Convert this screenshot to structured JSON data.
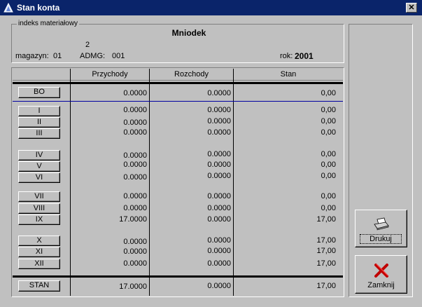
{
  "window": {
    "title": "Stan konta",
    "close_glyph": "✕"
  },
  "header": {
    "group_label": "indeks materiałowy",
    "material_name": "Mniodek",
    "code": "2",
    "magazyn_label": "magazyn:",
    "magazyn_value": "01",
    "admg_label": "ADMG:",
    "admg_value": "001",
    "rok_label": "rok:",
    "rok_value": "2001"
  },
  "table": {
    "columns": [
      "Przychody",
      "Rozchody",
      "Stan"
    ],
    "bo": {
      "label": "BO",
      "przychody": "0.0000",
      "rozchody": "0.0000",
      "stan": "0,00"
    },
    "rows": [
      {
        "label": "I",
        "przychody": "0.0000",
        "rozchody": "0.0000",
        "stan": "0,00"
      },
      {
        "label": "II",
        "przychody": "0.0000",
        "rozchody": "0.0000",
        "stan": "0,00"
      },
      {
        "label": "III",
        "przychody": "0.0000",
        "rozchody": "0.0000",
        "stan": "0,00"
      },
      {
        "label": "IV",
        "przychody": "0.0000",
        "rozchody": "0.0000",
        "stan": "0,00"
      },
      {
        "label": "V",
        "przychody": "0.0000",
        "rozchody": "0.0000",
        "stan": "0,00"
      },
      {
        "label": "VI",
        "przychody": "0.0000",
        "rozchody": "0.0000",
        "stan": "0,00"
      },
      {
        "label": "VII",
        "przychody": "0.0000",
        "rozchody": "0.0000",
        "stan": "0,00"
      },
      {
        "label": "VIII",
        "przychody": "0.0000",
        "rozchody": "0.0000",
        "stan": "0,00"
      },
      {
        "label": "IX",
        "przychody": "17.0000",
        "rozchody": "0.0000",
        "stan": "17,00"
      },
      {
        "label": "X",
        "przychody": "0.0000",
        "rozchody": "0.0000",
        "stan": "17,00"
      },
      {
        "label": "XI",
        "przychody": "0.0000",
        "rozchody": "0.0000",
        "stan": "17,00"
      },
      {
        "label": "XII",
        "przychody": "0.0000",
        "rozchody": "0.0000",
        "stan": "17,00"
      }
    ],
    "total": {
      "label": "STAN",
      "przychody": "17.0000",
      "rozchody": "0.0000",
      "stan": "17,00"
    }
  },
  "actions": {
    "print_label": "Drukuj",
    "close_label": "Zamknij"
  }
}
